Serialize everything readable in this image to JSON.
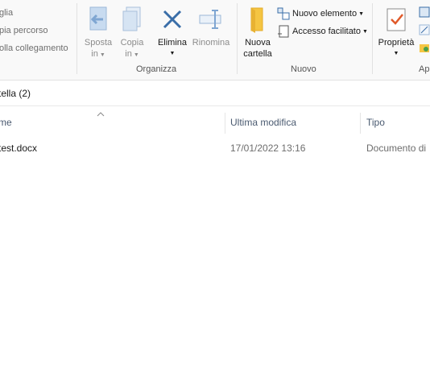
{
  "ribbon": {
    "clipboard": {
      "items": [
        "glia",
        "pia percorso",
        "olla collegamento"
      ]
    },
    "organize": {
      "label": "Organizza",
      "move_to": {
        "line1": "Sposta",
        "line2": "in"
      },
      "copy_to": {
        "line1": "Copia",
        "line2": "in"
      },
      "delete": {
        "label": "Elimina"
      },
      "rename": {
        "label": "Rinomina"
      }
    },
    "new": {
      "label": "Nuovo",
      "new_folder": {
        "line1": "Nuova",
        "line2": "cartella"
      },
      "new_item": "Nuovo elemento",
      "easy_access": "Accesso facilitato"
    },
    "open": {
      "label": "Ap",
      "properties": "Proprietà"
    }
  },
  "address": {
    "path": "tella (2)"
  },
  "columns": {
    "name": "me",
    "modified": "Ultima modifica",
    "type": "Tipo"
  },
  "files": [
    {
      "name": "test.docx",
      "modified": "17/01/2022 13:16",
      "type": "Documento di"
    }
  ],
  "colors": {
    "accent_blue": "#3a6ea8",
    "folder_yellow": "#f5c542",
    "check_red": "#e05a2a"
  }
}
